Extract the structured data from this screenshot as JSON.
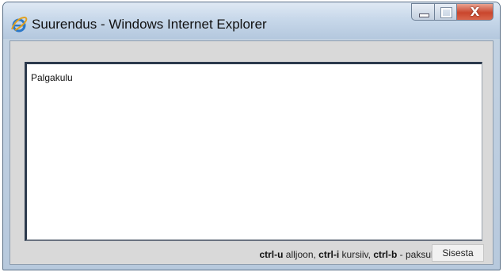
{
  "window": {
    "title": "Suurendus - Windows Internet Explorer",
    "caption_buttons": {
      "minimize_glyph": "—",
      "maximize_glyph": "□",
      "close_glyph": "X"
    }
  },
  "editor": {
    "content": "Palgakulu"
  },
  "hints": {
    "underline_key": "ctrl-u",
    "underline_desc": " alljoon, ",
    "italic_key": "ctrl-i",
    "italic_desc": " kursiiv, ",
    "bold_key": "ctrl-b",
    "bold_desc": " - paksult"
  },
  "insert_button": {
    "label": "Sisesta"
  },
  "colors": {
    "title_bar": "#c8d8ea",
    "close_button": "#c9462d",
    "client_background": "#d9d9d9"
  }
}
